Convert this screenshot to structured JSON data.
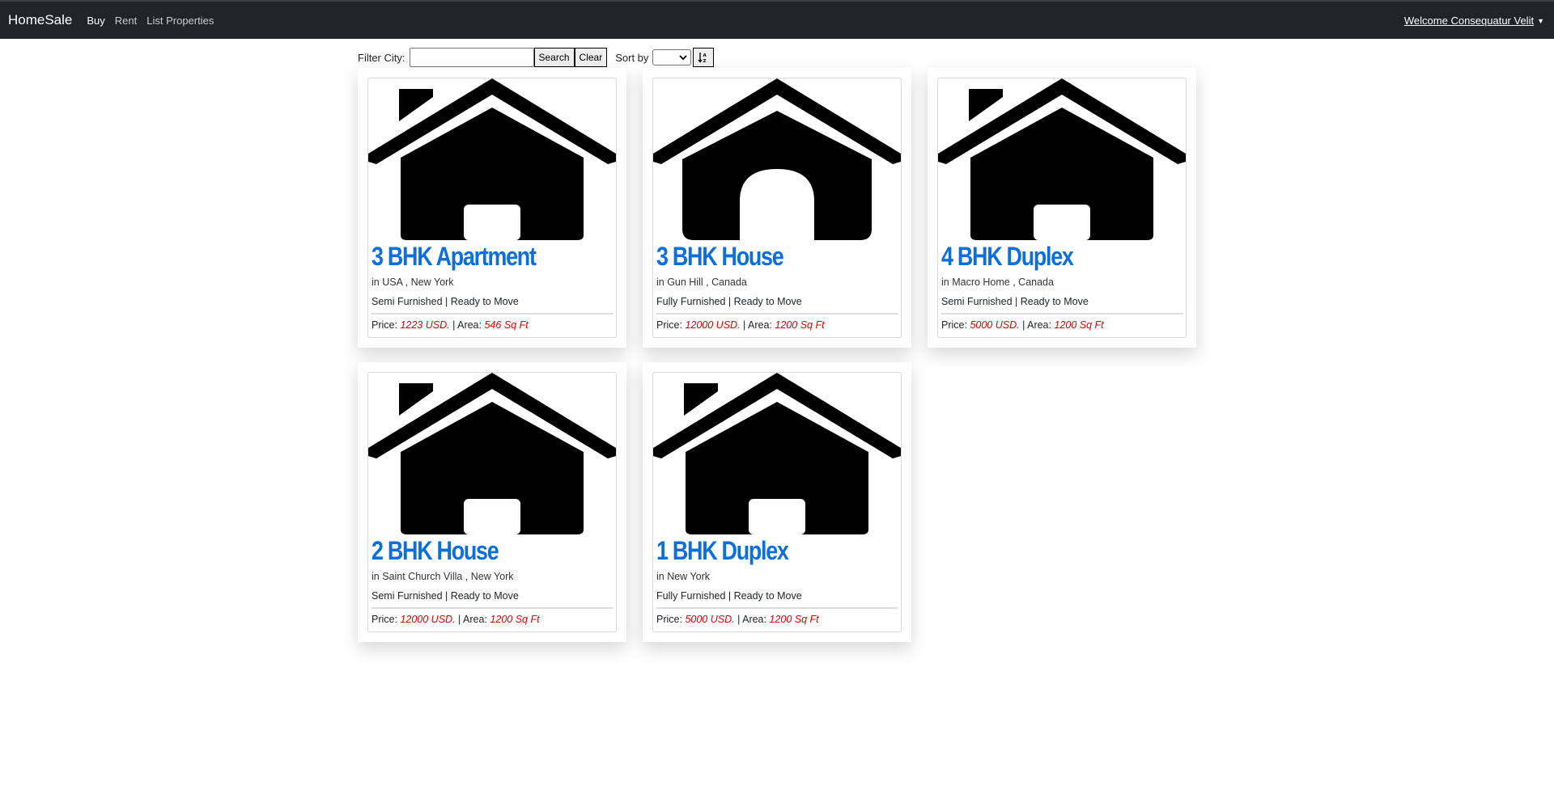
{
  "navbar": {
    "brand": "HomeSale",
    "links": [
      {
        "label": "Buy"
      },
      {
        "label": "Rent"
      },
      {
        "label": "List Properties"
      }
    ],
    "user_menu": "Welcome Consequatur Velit"
  },
  "filter": {
    "label": "Filter City:",
    "city_value": "",
    "search_label": "Search",
    "clear_label": "Clear",
    "sort_label": "Sort by",
    "sort_selected": "",
    "sort_icon": "sort-alpha-down-icon"
  },
  "properties": [
    {
      "title": "3 BHK Apartment",
      "location": "in USA , New York",
      "tags": "Semi Furnished | Ready to Move",
      "price_label": "Price:",
      "price": "1223 USD.",
      "area_label": "| Area:",
      "area": "546 Sq Ft",
      "icon": "house-chimney-icon"
    },
    {
      "title": "3 BHK House",
      "location": "in Gun Hill , Canada",
      "tags": "Fully Furnished | Ready to Move",
      "price_label": "Price:",
      "price": "12000 USD.",
      "area_label": "| Area:",
      "area": "1200 Sq Ft",
      "icon": "house-arch-icon"
    },
    {
      "title": "4 BHK Duplex",
      "location": "in Macro Home , Canada",
      "tags": "Semi Furnished | Ready to Move",
      "price_label": "Price:",
      "price": "5000 USD.",
      "area_label": "| Area:",
      "area": "1200 Sq Ft",
      "icon": "house-chimney-icon"
    },
    {
      "title": "2 BHK House",
      "location": "in Saint Church Villa , New York",
      "tags": "Semi Furnished | Ready to Move",
      "price_label": "Price:",
      "price": "12000 USD.",
      "area_label": "| Area:",
      "area": "1200 Sq Ft",
      "icon": "house-chimney-icon"
    },
    {
      "title": "1 BHK Duplex",
      "location": "in New York",
      "tags": "Fully Furnished | Ready to Move",
      "price_label": "Price:",
      "price": "5000 USD.",
      "area_label": "| Area:",
      "area": "1200 Sq Ft",
      "icon": "house-chimney-icon"
    }
  ],
  "colors": {
    "navbar_bg": "#212529",
    "title_blue": "#0d6fdc",
    "accent_red": "#e00000"
  }
}
